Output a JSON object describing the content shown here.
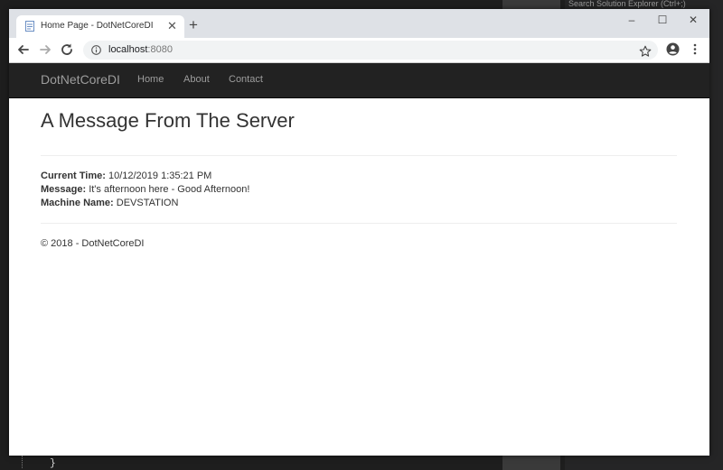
{
  "ide": {
    "search_placeholder": "Search Solution Explorer (Ctrl+;)",
    "code_fragment": "}"
  },
  "browser": {
    "tab": {
      "title": "Home Page - DotNetCoreDI"
    },
    "address": {
      "host": "localhost",
      "port": ":8080"
    }
  },
  "site": {
    "brand": "DotNetCoreDI",
    "nav": {
      "home": "Home",
      "about": "About",
      "contact": "Contact"
    },
    "title": "A Message From The Server",
    "details": {
      "time_label": "Current Time:",
      "time_value": " 10/12/2019 1:35:21 PM",
      "message_label": "Message:",
      "message_value": " It's afternoon here - Good Afternoon!",
      "machine_label": "Machine Name:",
      "machine_value": " DEVSTATION"
    },
    "footer": "© 2018 - DotNetCoreDI"
  }
}
